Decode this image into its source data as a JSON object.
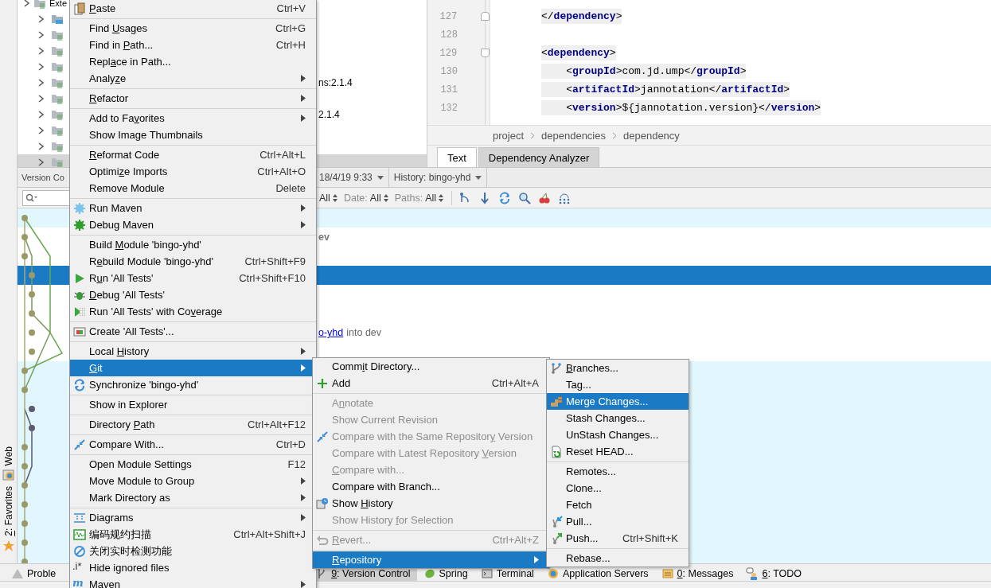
{
  "side_strip": [
    {
      "label": "Web"
    },
    {
      "label": "2: Favorites"
    }
  ],
  "project_tree": {
    "top_label": "Exte",
    "rows": [
      {
        "label": "",
        "selected": false
      },
      {
        "label": "",
        "selected": false
      },
      {
        "label": "",
        "selected": false
      },
      {
        "label": "",
        "selected": false
      },
      {
        "label": "ns:2.1.4",
        "selected": false
      },
      {
        "label": "",
        "selected": false
      },
      {
        "label": "2.1.4",
        "selected": false
      },
      {
        "label": "",
        "selected": false
      },
      {
        "label": "",
        "selected": false
      },
      {
        "label": "",
        "selected": true
      }
    ]
  },
  "editor": {
    "lines": [
      {
        "number": "127",
        "code": "</**dependency**>"
      },
      {
        "number": "128"
      },
      {
        "number": "129",
        "code": "<**dependency**>"
      },
      {
        "number": "130",
        "code": "    <**groupId**>com.jd.ump</**groupId**>"
      },
      {
        "number": "131",
        "code": "    <**artifactId**>jannotation</**artifactId**>"
      },
      {
        "number": "132",
        "code": "    <**version**>${jannotation.version}</**version**>"
      }
    ],
    "breadcrumb": [
      "project",
      "dependencies",
      "dependency"
    ],
    "tabs": [
      {
        "label": "Text",
        "selected": true
      },
      {
        "label": "Dependency Analyzer",
        "selected": false
      }
    ]
  },
  "version_control": {
    "title": "Version Co",
    "tabs": [
      {
        "label": "18/4/19 9:33"
      },
      {
        "label": "History: bingo-yhd"
      }
    ],
    "filters": [
      {
        "value": "All"
      },
      {
        "label": "Date:",
        "value": "All"
      },
      {
        "label": "Paths:",
        "value": "All"
      }
    ],
    "rows": [
      {
        "highlighted": true,
        "selected": false
      },
      {
        "highlighted": false,
        "selected": false,
        "subject": "ev"
      },
      {
        "highlighted": false,
        "selected": false
      },
      {
        "selected": true
      },
      {
        "highlighted": false,
        "selected": false
      },
      {
        "highlighted": false,
        "selected": false
      },
      {
        "highlighted": false,
        "selected": false,
        "link": "o-yhd",
        "subject": "into dev"
      },
      {
        "highlighted": false,
        "selected": false
      },
      {
        "highlighted": true,
        "selected": false
      },
      {
        "highlighted": true,
        "selected": false
      },
      {
        "highlighted": true,
        "selected": false
      },
      {
        "highlighted": true,
        "selected": false
      },
      {
        "highlighted": true,
        "selected": false
      },
      {
        "highlighted": true,
        "selected": false
      },
      {
        "highlighted": true,
        "selected": false
      },
      {
        "highlighted": true,
        "selected": false
      },
      {
        "highlighted": true,
        "selected": false
      },
      {
        "highlighted": true,
        "selected": false
      },
      {
        "highlighted": true,
        "selected": false
      }
    ]
  },
  "bottom_bar": [
    {
      "label": "Proble",
      "selected": false
    },
    {
      "label": "9: Version Control",
      "selected": true
    },
    {
      "label": "Spring",
      "selected": false
    },
    {
      "label": "Terminal",
      "selected": false
    },
    {
      "label": "Application Servers",
      "selected": false
    },
    {
      "label": "0: Messages",
      "selected": false
    },
    {
      "label": "6: TODO",
      "selected": false
    }
  ],
  "context_menu": [
    {
      "kind": "item",
      "label": "Paste",
      "shortcut": "Ctrl+V",
      "submenu": false,
      "selected": false
    },
    {
      "kind": "separator"
    },
    {
      "kind": "item",
      "label": "Find Usages",
      "shortcut": "Ctrl+G",
      "submenu": false,
      "selected": false
    },
    {
      "kind": "item",
      "label": "Find in Path...",
      "shortcut": "Ctrl+H",
      "submenu": false,
      "selected": false
    },
    {
      "kind": "item",
      "label": "Replace in Path...",
      "submenu": false,
      "selected": false
    },
    {
      "kind": "item",
      "label": "Analyze",
      "submenu": true,
      "selected": false
    },
    {
      "kind": "separator"
    },
    {
      "kind": "item",
      "label": "Refactor",
      "submenu": true,
      "selected": false
    },
    {
      "kind": "separator"
    },
    {
      "kind": "item",
      "label": "Add to Favorites",
      "submenu": true,
      "selected": false
    },
    {
      "kind": "item",
      "label": "Show Image Thumbnails",
      "submenu": false,
      "selected": false
    },
    {
      "kind": "separator"
    },
    {
      "kind": "item",
      "label": "Reformat Code",
      "shortcut": "Ctrl+Alt+L",
      "submenu": false,
      "selected": false
    },
    {
      "kind": "item",
      "label": "Optimize Imports",
      "shortcut": "Ctrl+Alt+O",
      "submenu": false,
      "selected": false
    },
    {
      "kind": "item",
      "label": "Remove Module",
      "shortcut": "Delete",
      "submenu": false,
      "selected": false
    },
    {
      "kind": "separator"
    },
    {
      "kind": "item",
      "label": "Run Maven",
      "submenu": true,
      "selected": false
    },
    {
      "kind": "item",
      "label": "Debug Maven",
      "submenu": true,
      "selected": false
    },
    {
      "kind": "separator"
    },
    {
      "kind": "item",
      "label": "Build Module 'bingo-yhd'",
      "submenu": false,
      "selected": false
    },
    {
      "kind": "item",
      "label": "Rebuild Module 'bingo-yhd'",
      "shortcut": "Ctrl+Shift+F9",
      "submenu": false,
      "selected": false
    },
    {
      "kind": "item",
      "label": "Run 'All Tests'",
      "shortcut": "Ctrl+Shift+F10",
      "submenu": false,
      "selected": false
    },
    {
      "kind": "item",
      "label": "Debug 'All Tests'",
      "submenu": false,
      "selected": false
    },
    {
      "kind": "item",
      "label": "Run 'All Tests' with Coverage",
      "submenu": false,
      "selected": false
    },
    {
      "kind": "separator"
    },
    {
      "kind": "item",
      "label": "Create 'All Tests'...",
      "submenu": false,
      "selected": false
    },
    {
      "kind": "separator"
    },
    {
      "kind": "item",
      "label": "Local History",
      "submenu": true,
      "selected": false
    },
    {
      "kind": "item",
      "label": "Git",
      "submenu": true,
      "selected": true
    },
    {
      "kind": "item",
      "label": "Synchronize 'bingo-yhd'",
      "submenu": false,
      "selected": false
    },
    {
      "kind": "separator"
    },
    {
      "kind": "item",
      "label": "Show in Explorer",
      "submenu": false,
      "selected": false
    },
    {
      "kind": "separator"
    },
    {
      "kind": "item",
      "label": "Directory Path",
      "shortcut": "Ctrl+Alt+F12",
      "submenu": false,
      "selected": false
    },
    {
      "kind": "separator"
    },
    {
      "kind": "item",
      "label": "Compare With...",
      "shortcut": "Ctrl+D",
      "submenu": false,
      "selected": false
    },
    {
      "kind": "separator"
    },
    {
      "kind": "item",
      "label": "Open Module Settings",
      "shortcut": "F12",
      "submenu": false,
      "selected": false
    },
    {
      "kind": "item",
      "label": "Move Module to Group",
      "submenu": true,
      "selected": false
    },
    {
      "kind": "item",
      "label": "Mark Directory as",
      "submenu": true,
      "selected": false
    },
    {
      "kind": "separator"
    },
    {
      "kind": "item",
      "label": "Diagrams",
      "submenu": true,
      "selected": false
    },
    {
      "kind": "item",
      "label": "编码规约扫描",
      "shortcut": "Ctrl+Alt+Shift+J",
      "submenu": false,
      "selected": false
    },
    {
      "kind": "item",
      "label": "关闭实时检测功能",
      "submenu": false,
      "selected": false
    },
    {
      "kind": "item",
      "label": "Hide ignored files",
      "icon_text": ".i*",
      "submenu": false,
      "selected": false
    },
    {
      "kind": "item",
      "label": "Maven",
      "icon_text": "m",
      "submenu": true,
      "selected": false
    }
  ],
  "git_menu": [
    {
      "kind": "item",
      "label": "Commit Directory...",
      "submenu": false,
      "selected": false,
      "disabled": false
    },
    {
      "kind": "item",
      "label": "Add",
      "shortcut": "Ctrl+Alt+A",
      "submenu": false,
      "selected": false,
      "disabled": false
    },
    {
      "kind": "separator"
    },
    {
      "kind": "item",
      "label": "Annotate",
      "submenu": false,
      "selected": false,
      "disabled": true
    },
    {
      "kind": "item",
      "label": "Show Current Revision",
      "submenu": false,
      "selected": false,
      "disabled": true
    },
    {
      "kind": "item",
      "label": "Compare with the Same Repository Version",
      "submenu": false,
      "selected": false,
      "disabled": true
    },
    {
      "kind": "item",
      "label": "Compare with Latest Repository Version",
      "submenu": false,
      "selected": false,
      "disabled": true
    },
    {
      "kind": "item",
      "label": "Compare with...",
      "submenu": false,
      "selected": false,
      "disabled": true
    },
    {
      "kind": "item",
      "label": "Compare with Branch...",
      "submenu": false,
      "selected": false,
      "disabled": false
    },
    {
      "kind": "item",
      "label": "Show History",
      "submenu": false,
      "selected": false,
      "disabled": false
    },
    {
      "kind": "item",
      "label": "Show History for Selection",
      "submenu": false,
      "selected": false,
      "disabled": true
    },
    {
      "kind": "separator"
    },
    {
      "kind": "item",
      "label": "Revert...",
      "shortcut": "Ctrl+Alt+Z",
      "submenu": false,
      "selected": false,
      "disabled": true
    },
    {
      "kind": "separator"
    },
    {
      "kind": "item",
      "label": "Repository",
      "submenu": true,
      "selected": true,
      "disabled": false
    }
  ],
  "repository_menu": [
    {
      "kind": "item",
      "label": "Branches...",
      "submenu": false,
      "selected": false
    },
    {
      "kind": "item",
      "label": "Tag...",
      "submenu": false,
      "selected": false
    },
    {
      "kind": "item",
      "label": "Merge Changes...",
      "submenu": false,
      "selected": true
    },
    {
      "kind": "item",
      "label": "Stash Changes...",
      "submenu": false,
      "selected": false
    },
    {
      "kind": "item",
      "label": "UnStash Changes...",
      "submenu": false,
      "selected": false
    },
    {
      "kind": "item",
      "label": "Reset HEAD...",
      "submenu": false,
      "selected": false
    },
    {
      "kind": "separator"
    },
    {
      "kind": "item",
      "label": "Remotes...",
      "submenu": false,
      "selected": false
    },
    {
      "kind": "item",
      "label": "Clone...",
      "submenu": false,
      "selected": false
    },
    {
      "kind": "item",
      "label": "Fetch",
      "submenu": false,
      "selected": false
    },
    {
      "kind": "item",
      "label": "Pull...",
      "submenu": false,
      "selected": false
    },
    {
      "kind": "item",
      "label": "Push...",
      "shortcut": "Ctrl+Shift+K",
      "submenu": false,
      "selected": false
    },
    {
      "kind": "separator"
    },
    {
      "kind": "item",
      "label": "Rebase...",
      "submenu": false,
      "selected": false
    }
  ]
}
